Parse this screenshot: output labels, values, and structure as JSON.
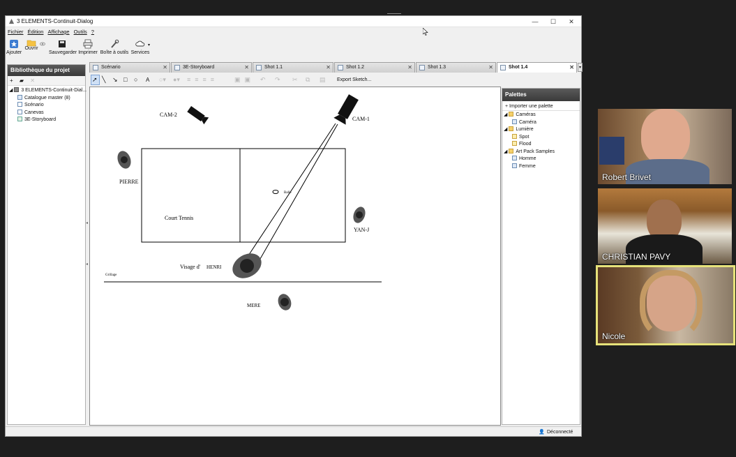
{
  "window": {
    "title": "3 ELEMENTS-Continuit-Dialog",
    "minimize": "—",
    "maximize": "☐",
    "close": "✕"
  },
  "menu": [
    "Fichier",
    "Édition",
    "Affichage",
    "Outils",
    "?"
  ],
  "toolbar": [
    {
      "label": "Ajouter",
      "icon": "add-icon"
    },
    {
      "label": "Ouvrir",
      "icon": "folder-icon"
    },
    {
      "label": "Sauvegarder",
      "icon": "save-icon"
    },
    {
      "label": "Imprimer",
      "icon": "printer-icon"
    },
    {
      "label": "Boîte à outils",
      "icon": "tools-icon"
    },
    {
      "label": "Services",
      "icon": "cloud-icon"
    }
  ],
  "library": {
    "title": "Bibliothèque du projet",
    "root": "3 ELEMENTS-Continuit-Dial...",
    "items": [
      "Catalogue master (8)",
      "Scénario",
      "Canevas",
      "3E-Storyboard"
    ]
  },
  "tabs": [
    {
      "label": "Scénario"
    },
    {
      "label": "3E-Storyboard"
    },
    {
      "label": "Shot 1.1"
    },
    {
      "label": "Shot 1.2"
    },
    {
      "label": "Shot 1.3"
    },
    {
      "label": "Shot 1.4",
      "active": true
    }
  ],
  "draw_toolbar": {
    "export_label": "Export Sketch..."
  },
  "canvas": {
    "labels": {
      "cam2": "CAM-2",
      "cam1": "CAM-1",
      "pierre": "PIERRE",
      "court": "Court Tennis",
      "balle": "Balle",
      "yanj": "YAN-J",
      "visage": "Visage d'",
      "henri": "HENRI",
      "grillage": "Grillage",
      "mere": "MERE"
    }
  },
  "palettes": {
    "title": "Palettes",
    "import": "Importer une palette",
    "tree": [
      {
        "label": "Caméras",
        "children": [
          "Caméra"
        ]
      },
      {
        "label": "Lumière",
        "children": [
          "Spot",
          "Flood"
        ]
      },
      {
        "label": "Art Pack Samples",
        "children": [
          "Homme",
          "Femme"
        ]
      }
    ]
  },
  "status": {
    "connection": "Déconnecté"
  },
  "participants": [
    {
      "name": "Robert Brivet"
    },
    {
      "name": "CHRISTIAN PAVY"
    },
    {
      "name": "Nicole",
      "active_speaker": true
    }
  ],
  "colors": {
    "panel_header": "#4a4a4a",
    "speaker_border": "#e6e27a",
    "background": "#1e1e1e"
  }
}
